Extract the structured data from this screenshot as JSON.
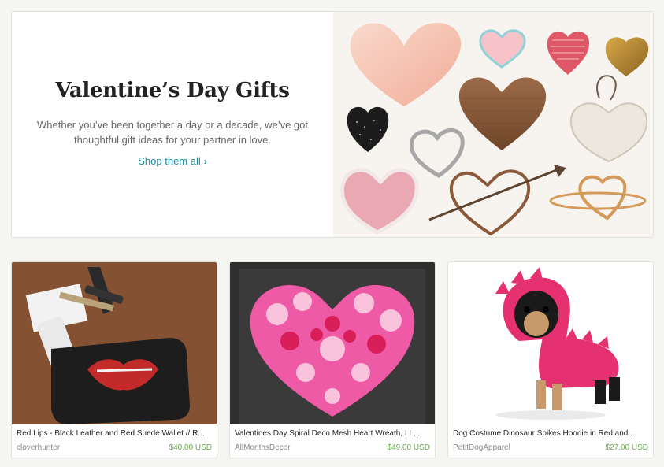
{
  "hero": {
    "title": "Valentine’s Day Gifts",
    "description": "Whether you’ve been together a day or a decade, we’ve got thoughtful gift ideas for your partner in love.",
    "link_label": "Shop them all",
    "link_icon": "chevron-right-icon"
  },
  "listings": [
    {
      "title": "Red Lips - Black Leather and Red Suede Wallet // R...",
      "shop": "cloverhunter",
      "price": "$40.00 USD"
    },
    {
      "title": "Valentines Day Spiral Deco Mesh Heart Wreath, I L...",
      "shop": "AllMonthsDecor",
      "price": "$49.00 USD"
    },
    {
      "title": "Dog Costume Dinosaur Spikes Hoodie in Red and ...",
      "shop": "PetitDogApparel",
      "price": "$27.00 USD"
    }
  ],
  "colors": {
    "link": "#1a8b9e",
    "price": "#6aa84f",
    "page_bg": "#f5f5f1"
  }
}
